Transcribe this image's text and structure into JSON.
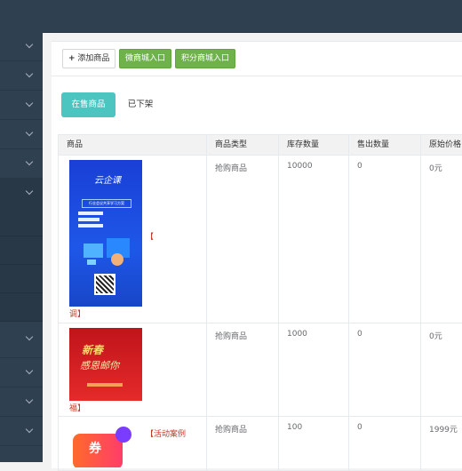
{
  "toolbar": {
    "add_label": "添加商品",
    "micro_mall_label": "微商城入口",
    "points_mall_label": "积分商城入口"
  },
  "tabs": [
    {
      "label": "在售商品",
      "active": true
    },
    {
      "label": "已下架",
      "active": false
    }
  ],
  "table": {
    "headers": [
      "商品",
      "商品类型",
      "库存数量",
      "售出数量",
      "原始价格"
    ],
    "rows": [
      {
        "name_prefix": "【",
        "name_tail": "调】",
        "type": "抢购商品",
        "stock": "10000",
        "sold": "0",
        "price": "0元",
        "poster": {
          "brand": "云企课",
          "caption": "行业会议共享学习方案"
        }
      },
      {
        "name_prefix": "",
        "name_tail": "福】",
        "type": "抢购商品",
        "stock": "1000",
        "sold": "0",
        "price": "0元",
        "poster": {
          "line1": "新春",
          "line2": "感恩邮你"
        }
      },
      {
        "name_prefix": "【活动案例",
        "name_tail": "",
        "type": "抢购商品",
        "stock": "100",
        "sold": "0",
        "price": "1999元",
        "poster": {
          "line1": "券"
        }
      }
    ]
  },
  "colors": {
    "sidebar": "#2f4050",
    "teal": "#4cc5c0",
    "green": "#6fb14a",
    "name_red": "#c0392b"
  }
}
